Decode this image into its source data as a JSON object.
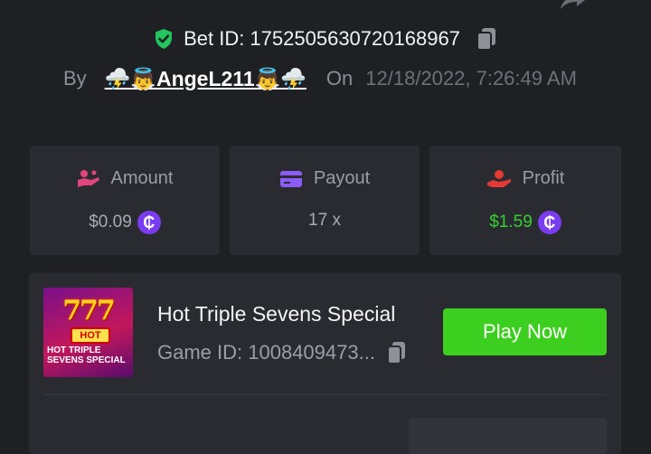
{
  "bet": {
    "id_label": "Bet ID: 1752505630720168967",
    "by_label": "By",
    "username": "⛈️👼AngeL211👼⛈️",
    "on_label": "On",
    "datetime": "12/18/2022, 7:26:49 AM"
  },
  "stats": [
    {
      "label": "Amount",
      "value": "$0.09",
      "currency_symbol": "₵",
      "icon": "hand-coins-icon"
    },
    {
      "label": "Payout",
      "value": "17 x",
      "icon": "wallet-card-icon"
    },
    {
      "label": "Profit",
      "value": "$1.59",
      "currency_symbol": "₵",
      "icon": "hand-money-icon"
    }
  ],
  "game": {
    "title": "Hot Triple Sevens Special",
    "id_label": "Game ID: 1008409473...",
    "play_label": "Play Now",
    "thumbnail": {
      "badge": "HOT",
      "text_line1": "HOT TRIPLE",
      "text_line2": "SEVENS SPECIAL"
    }
  },
  "colors": {
    "background": "#1f2024",
    "card": "#2a2b30",
    "accent_green": "#3dcf1f",
    "profit_green": "#35d12f",
    "coin_purple": "#7a3cf0",
    "amount_icon": "#e0457b",
    "payout_icon": "#8b5cf6",
    "profit_icon": "#e53935"
  }
}
